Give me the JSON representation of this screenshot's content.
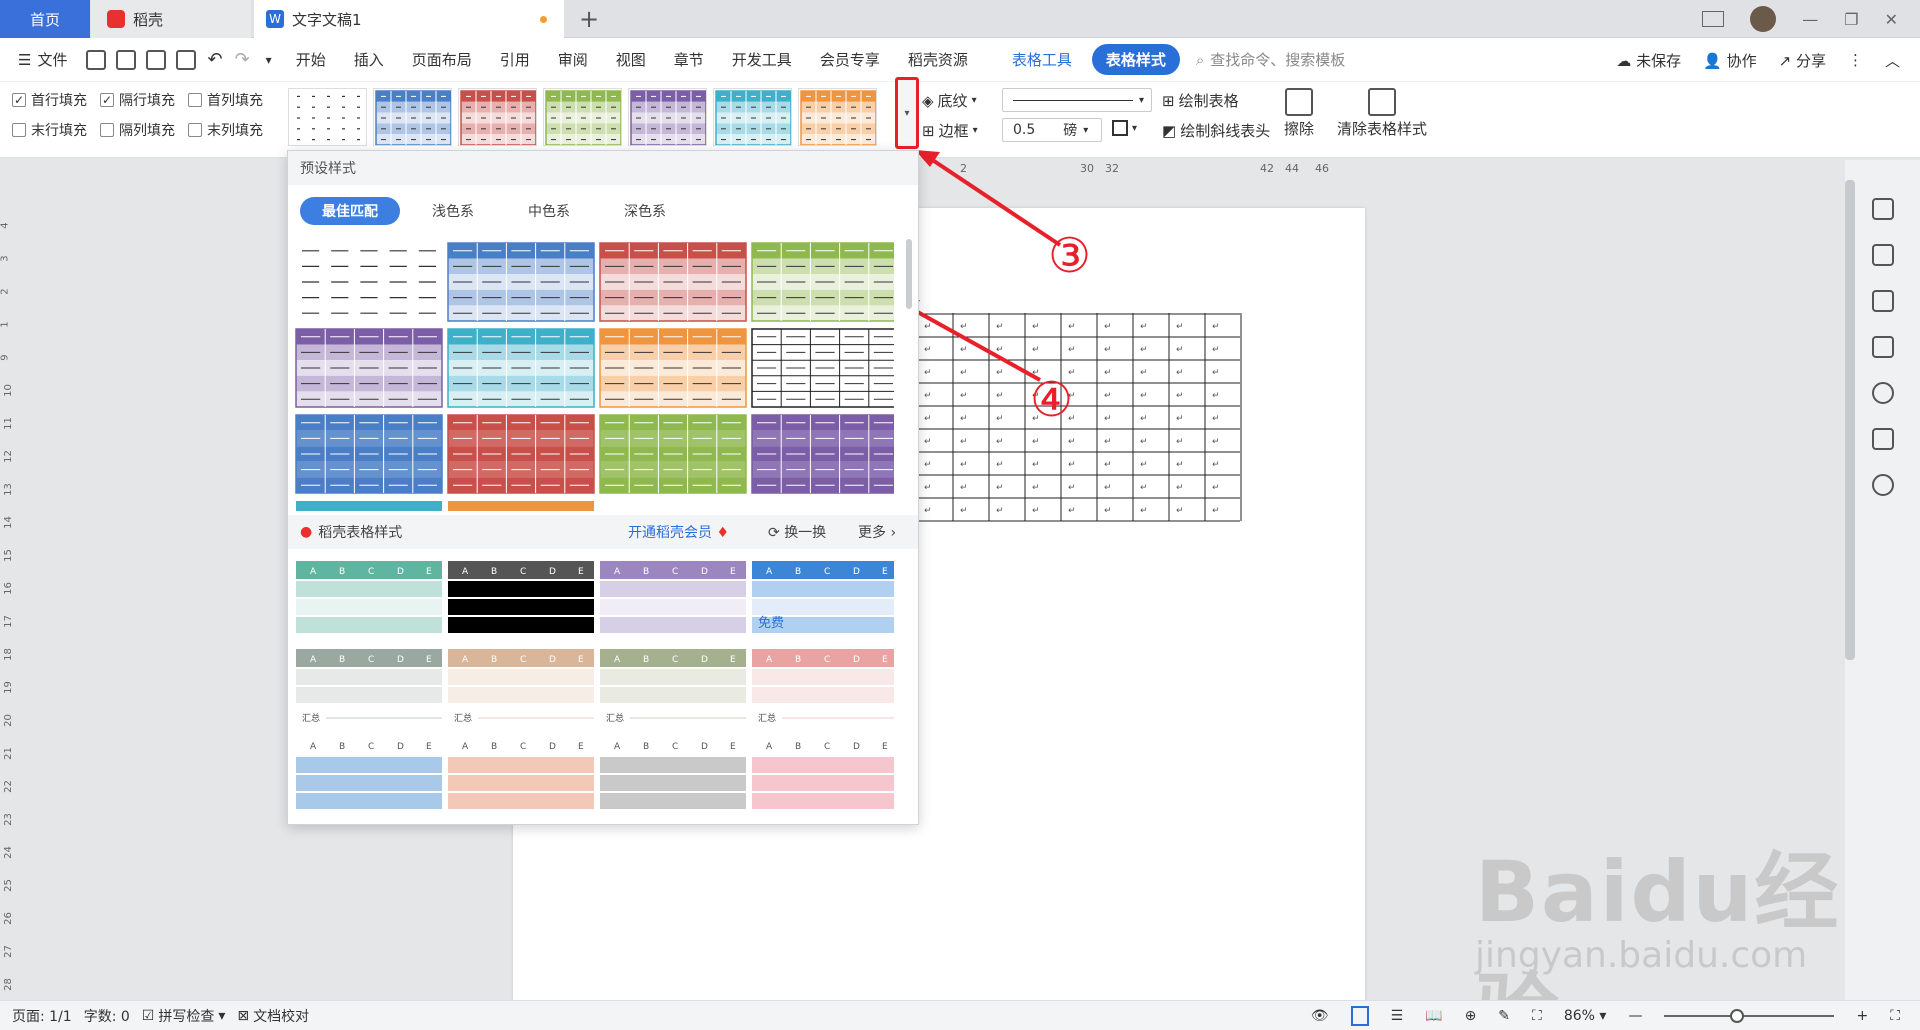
{
  "titlebar": {
    "home": "首页",
    "daoke": "稻壳",
    "doc": "文字文稿1",
    "add": "+"
  },
  "menu": {
    "file": "文件",
    "items": [
      "开始",
      "插入",
      "页面布局",
      "引用",
      "审阅",
      "视图",
      "章节",
      "开发工具",
      "会员专享",
      "稻壳资源"
    ],
    "table_tools": "表格工具",
    "table_style": "表格样式",
    "search": "查找命令、搜索模板",
    "unsaved": "未保存",
    "collab": "协作",
    "share": "分享"
  },
  "ribbon": {
    "checks": [
      {
        "label": "首行填充",
        "checked": true
      },
      {
        "label": "隔行填充",
        "checked": true
      },
      {
        "label": "首列填充",
        "checked": false
      },
      {
        "label": "末行填充",
        "checked": false
      },
      {
        "label": "隔列填充",
        "checked": false
      },
      {
        "label": "末列填充",
        "checked": false
      }
    ],
    "shading": "底纹",
    "border": "边框",
    "line_width": "0.5",
    "unit": "磅",
    "draw_table": "绘制表格",
    "draw_diag": "绘制斜线表头",
    "erase": "擦除",
    "clear": "清除表格样式"
  },
  "ruler_nums": [
    "2",
    "30",
    "32",
    "42",
    "44",
    "46"
  ],
  "vruler_nums": [
    "4",
    "3",
    "2",
    "1",
    "9",
    "10",
    "11",
    "12",
    "13",
    "14",
    "15",
    "16",
    "17",
    "18",
    "19",
    "20",
    "21",
    "22",
    "23",
    "24",
    "25",
    "26",
    "27",
    "28"
  ],
  "panel": {
    "title": "预设样式",
    "tabs": [
      "最佳匹配",
      "浅色系",
      "中色系",
      "深色系"
    ],
    "daoke_title": "稻壳表格样式",
    "vip": "开通稻壳会员",
    "swap": "换一换",
    "more": "更多",
    "free": "免费",
    "summary": "汇总",
    "cols": [
      "A",
      "B",
      "C",
      "D",
      "E"
    ]
  },
  "annotations": {
    "three": "③",
    "four": "④"
  },
  "status": {
    "page": "页面: 1/1",
    "words": "字数: 0",
    "spell": "拼写检查",
    "proof": "文档校对",
    "zoom": "86%"
  },
  "watermark": {
    "main": "Baidu经验",
    "url": "jingyan.baidu.com"
  },
  "colors": {
    "blue": "#4a7fc7",
    "red": "#c9504a",
    "green": "#8fb84e",
    "purple": "#7b5ea7",
    "cyan": "#3eb0c9",
    "orange": "#f0953f",
    "accent": "#2a6fd8"
  }
}
